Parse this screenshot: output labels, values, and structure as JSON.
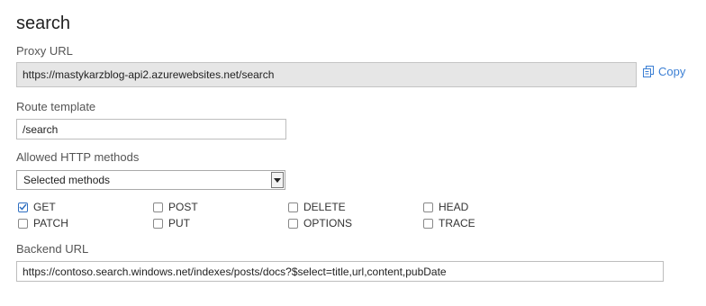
{
  "page": {
    "title": "search"
  },
  "proxy_url": {
    "label": "Proxy URL",
    "value": "https://mastykarzblog-api2.azurewebsites.net/search",
    "copy_label": "Copy"
  },
  "route_template": {
    "label": "Route template",
    "value": "/search"
  },
  "allowed_methods": {
    "label": "Allowed HTTP methods",
    "selected": "Selected methods",
    "methods": [
      {
        "label": "GET",
        "checked": true
      },
      {
        "label": "POST",
        "checked": false
      },
      {
        "label": "DELETE",
        "checked": false
      },
      {
        "label": "HEAD",
        "checked": false
      },
      {
        "label": "PATCH",
        "checked": false
      },
      {
        "label": "PUT",
        "checked": false
      },
      {
        "label": "OPTIONS",
        "checked": false
      },
      {
        "label": "TRACE",
        "checked": false
      }
    ]
  },
  "backend_url": {
    "label": "Backend URL",
    "value": "https://contoso.search.windows.net/indexes/posts/docs?$select=title,url,content,pubDate"
  },
  "colors": {
    "accent": "#3b7fd4",
    "readonly_bg": "#e6e6e6",
    "border": "#bdbdbd"
  },
  "icons": {
    "copy": "copy-icon",
    "dropdown": "chevron-down-icon",
    "check": "checkmark-icon"
  }
}
